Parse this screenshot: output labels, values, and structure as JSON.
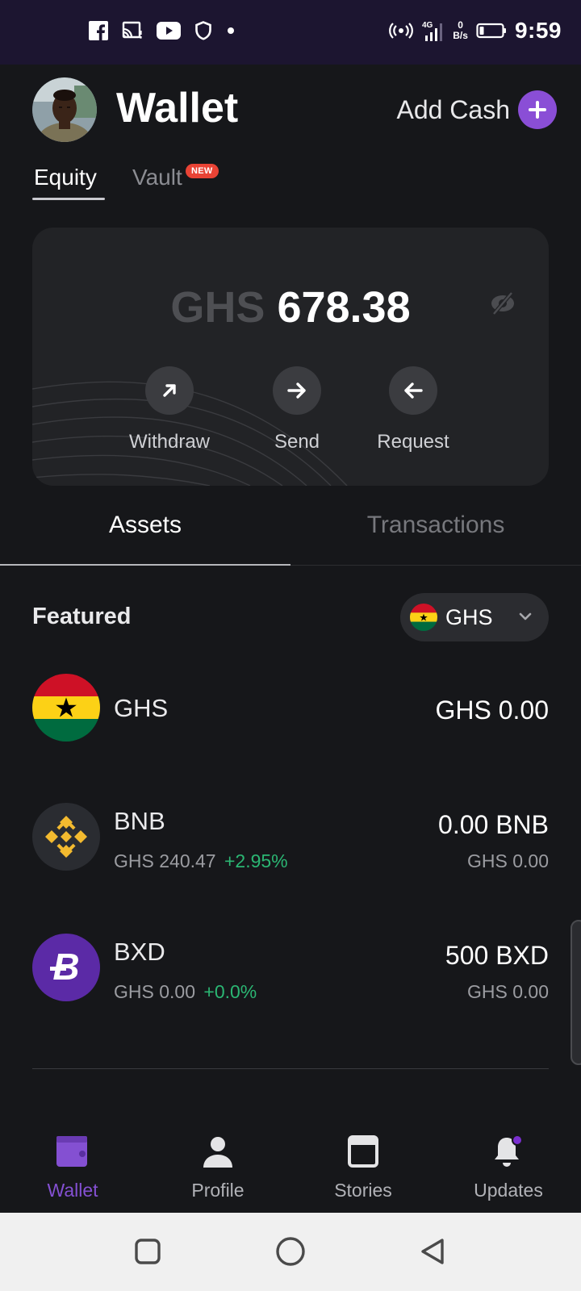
{
  "status_bar": {
    "time": "9:59",
    "net_speed_top": "0",
    "net_speed_unit": "B/s",
    "network": "4G",
    "left_icons": [
      "facebook-icon",
      "cast-icon",
      "youtube-icon",
      "shield-icon",
      "dot-icon"
    ],
    "right_icons": [
      "hotspot-icon",
      "signal-icon",
      "battery-icon"
    ]
  },
  "header": {
    "title": "Wallet",
    "add_cash_label": "Add Cash"
  },
  "sub_tabs": {
    "equity": "Equity",
    "vault": "Vault",
    "vault_badge": "NEW"
  },
  "balance_card": {
    "currency": "GHS",
    "amount": "678.38",
    "actions": {
      "withdraw": "Withdraw",
      "send": "Send",
      "request": "Request"
    }
  },
  "tabs": {
    "assets": "Assets",
    "transactions": "Transactions",
    "active": "Assets"
  },
  "featured": {
    "title": "Featured",
    "currency_selector": "GHS"
  },
  "assets": [
    {
      "symbol": "GHS",
      "price": "",
      "change": "",
      "balance": "GHS 0.00",
      "value": ""
    },
    {
      "symbol": "BNB",
      "price": "GHS 240.47",
      "change": "+2.95%",
      "balance": "0.00 BNB",
      "value": "GHS 0.00"
    },
    {
      "symbol": "BXD",
      "price": "GHS 0.00",
      "change": "+0.0%",
      "balance": "500 BXD",
      "value": "GHS 0.00"
    }
  ],
  "bottom_nav": {
    "items": [
      {
        "label": "Wallet",
        "icon": "wallet-icon",
        "active": true
      },
      {
        "label": "Profile",
        "icon": "profile-icon",
        "active": false
      },
      {
        "label": "Stories",
        "icon": "stories-icon",
        "active": false
      },
      {
        "label": "Updates",
        "icon": "bell-icon",
        "active": false
      }
    ]
  },
  "colors": {
    "accent": "#8450d2",
    "positive": "#2bb673",
    "background": "#16171a",
    "card": "#222326",
    "badge": "#e94335",
    "status_bar": "#1c1530"
  }
}
